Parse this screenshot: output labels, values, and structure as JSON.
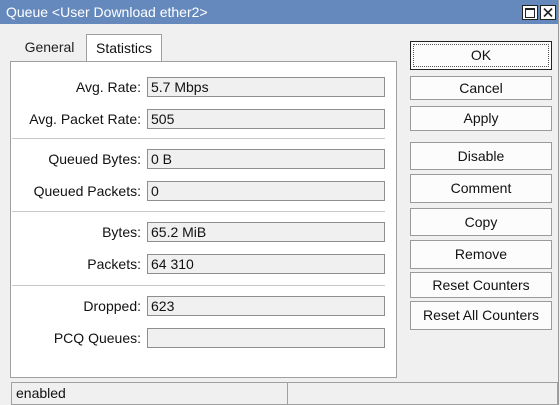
{
  "window": {
    "title": "Queue <User Download ether2>"
  },
  "tabs": [
    {
      "label": "General"
    },
    {
      "label": "Statistics",
      "active": true
    }
  ],
  "stats": {
    "avg_rate": {
      "label": "Avg. Rate:",
      "value": "5.7 Mbps"
    },
    "avg_packet_rate": {
      "label": "Avg. Packet Rate:",
      "value": "505"
    },
    "queued_bytes": {
      "label": "Queued Bytes:",
      "value": "0 B"
    },
    "queued_packets": {
      "label": "Queued Packets:",
      "value": "0"
    },
    "bytes": {
      "label": "Bytes:",
      "value": "65.2 MiB"
    },
    "packets": {
      "label": "Packets:",
      "value": "64 310"
    },
    "dropped": {
      "label": "Dropped:",
      "value": "623"
    },
    "pcq_queues": {
      "label": "PCQ Queues:",
      "value": ""
    }
  },
  "buttons": {
    "ok": "OK",
    "cancel": "Cancel",
    "apply": "Apply",
    "disable": "Disable",
    "comment": "Comment",
    "copy": "Copy",
    "remove": "Remove",
    "reset_counters": "Reset Counters",
    "reset_all_counters": "Reset All Counters"
  },
  "status_bar": {
    "left": "enabled",
    "right": ""
  },
  "colors": {
    "titlebar": "#6689bd",
    "window_bg": "#f0f0f0",
    "panel_bg": "#ffffff"
  }
}
